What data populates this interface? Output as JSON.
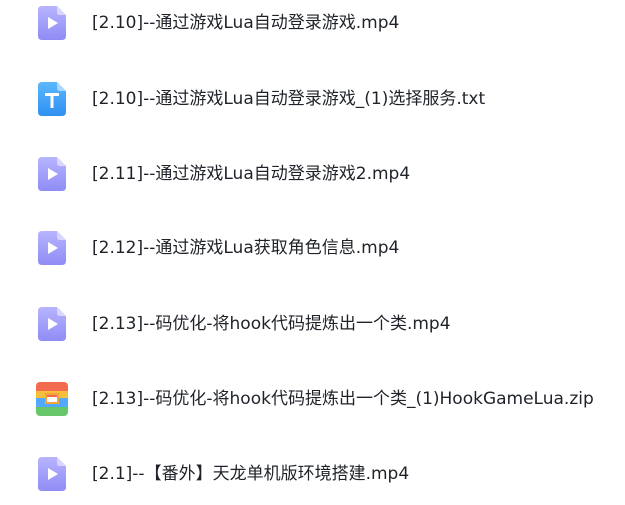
{
  "files": [
    {
      "name": "[2.10]--通过游戏Lua自动登录游戏.mp4",
      "icon": "video-file-icon"
    },
    {
      "name": "[2.10]--通过游戏Lua自动登录游戏_(1)选择服务.txt",
      "icon": "text-file-icon"
    },
    {
      "name": "[2.11]--通过游戏Lua自动登录游戏2.mp4",
      "icon": "video-file-icon"
    },
    {
      "name": "[2.12]--通过游戏Lua获取角色信息.mp4",
      "icon": "video-file-icon"
    },
    {
      "name": "[2.13]--码优化-将hook代码提炼出一个类.mp4",
      "icon": "video-file-icon"
    },
    {
      "name": "[2.13]--码优化-将hook代码提炼出一个类_(1)HookGameLua.zip",
      "icon": "zip-file-icon"
    },
    {
      "name": "[2.1]--【番外】天龙单机版环境搭建.mp4",
      "icon": "video-file-icon"
    }
  ],
  "colors": {
    "video_icon_top": "#b7b4ff",
    "video_icon_bottom": "#8f8cf5",
    "text_icon_top": "#5bb8ff",
    "text_icon_bottom": "#2f90f0",
    "zip_orange": "#f26b4f",
    "zip_yellow": "#f6bf3b",
    "zip_blue": "#53a9ff",
    "zip_green": "#67c66a",
    "text": "#1f2329"
  }
}
